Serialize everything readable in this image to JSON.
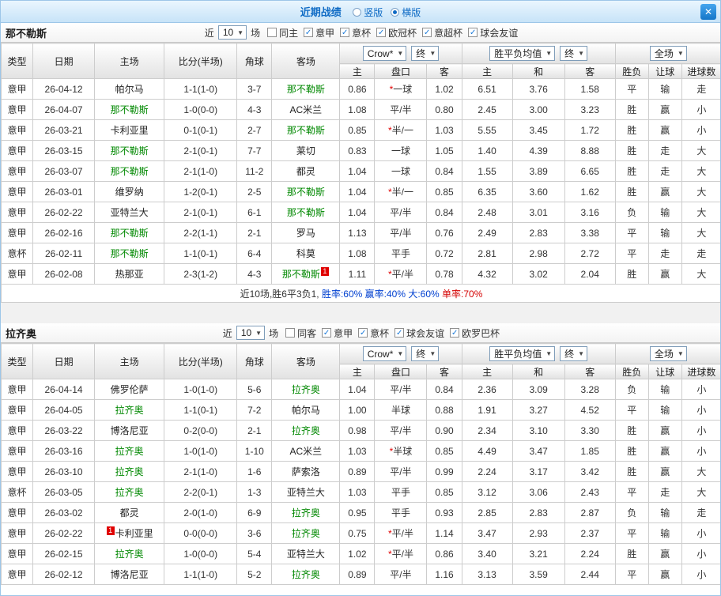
{
  "header": {
    "title": "近期战绩",
    "close_glyph": "✕",
    "layout_options": [
      {
        "label": "竖版",
        "selected": false
      },
      {
        "label": "横版",
        "selected": true
      }
    ]
  },
  "palette": {
    "accent_blue": "#1e8ae2",
    "focus_team_green": "#008800",
    "win_red": "#e00000",
    "draw_blue": "#0040d0",
    "lose_green": "#009100",
    "score_red": "#d40000",
    "odds_blue": "#2a52c0"
  },
  "columns": {
    "main": [
      "类型",
      "日期",
      "主场",
      "比分(半场)",
      "角球",
      "客场"
    ],
    "sub": [
      "主",
      "盘口",
      "客",
      "主",
      "和",
      "客",
      "胜负",
      "让球",
      "进球数"
    ]
  },
  "league_colors": {
    "意甲": "lg-blue",
    "意杯": "lg-purple"
  },
  "result_colors": {
    "胜": "r",
    "赢": "r",
    "大": "r",
    "平": "b",
    "走": "b",
    "负": "g",
    "输": "g",
    "小": "g"
  },
  "sections": [
    {
      "team": "那不勒斯",
      "filter": {
        "prefix": "近",
        "count": "10",
        "suffix": "场",
        "checkboxes": [
          {
            "label": "同主",
            "checked": false
          },
          {
            "label": "意甲",
            "checked": true
          },
          {
            "label": "意杯",
            "checked": true
          },
          {
            "label": "欧冠杯",
            "checked": true
          },
          {
            "label": "意超杯",
            "checked": true
          },
          {
            "label": "球会友谊",
            "checked": true
          }
        ]
      },
      "dropdowns": {
        "company": "Crow*",
        "final1": "终",
        "avg": "胜平负均值",
        "final2": "终",
        "scope": "全场"
      },
      "rows": [
        {
          "league": "意甲",
          "date": "26-04-12",
          "home": "帕尔马",
          "homeFocus": false,
          "homeBadge": "",
          "score": "1-1(1-0)",
          "corner": "3-7",
          "away": "那不勒斯",
          "awayFocus": true,
          "awayBadge": "",
          "odds": [
            "0.86",
            "*一球",
            "1.02"
          ],
          "avg": [
            "6.51",
            "3.76",
            "1.58"
          ],
          "results": [
            "平",
            "输",
            "走"
          ]
        },
        {
          "league": "意甲",
          "date": "26-04-07",
          "home": "那不勒斯",
          "homeFocus": true,
          "homeBadge": "",
          "score": "1-0(0-0)",
          "corner": "4-3",
          "away": "AC米兰",
          "awayFocus": false,
          "awayBadge": "",
          "odds": [
            "1.08",
            "平/半",
            "0.80"
          ],
          "avg": [
            "2.45",
            "3.00",
            "3.23"
          ],
          "results": [
            "胜",
            "赢",
            "小"
          ]
        },
        {
          "league": "意甲",
          "date": "26-03-21",
          "home": "卡利亚里",
          "homeFocus": false,
          "homeBadge": "",
          "score": "0-1(0-1)",
          "corner": "2-7",
          "away": "那不勒斯",
          "awayFocus": true,
          "awayBadge": "",
          "odds": [
            "0.85",
            "*半/一",
            "1.03"
          ],
          "avg": [
            "5.55",
            "3.45",
            "1.72"
          ],
          "results": [
            "胜",
            "赢",
            "小"
          ]
        },
        {
          "league": "意甲",
          "date": "26-03-15",
          "home": "那不勒斯",
          "homeFocus": true,
          "homeBadge": "",
          "score": "2-1(0-1)",
          "corner": "7-7",
          "away": "莱切",
          "awayFocus": false,
          "awayBadge": "",
          "odds": [
            "0.83",
            "一球",
            "1.05"
          ],
          "avg": [
            "1.40",
            "4.39",
            "8.88"
          ],
          "results": [
            "胜",
            "走",
            "大"
          ]
        },
        {
          "league": "意甲",
          "date": "26-03-07",
          "home": "那不勒斯",
          "homeFocus": true,
          "homeBadge": "",
          "score": "2-1(1-0)",
          "corner": "11-2",
          "away": "都灵",
          "awayFocus": false,
          "awayBadge": "",
          "odds": [
            "1.04",
            "一球",
            "0.84"
          ],
          "avg": [
            "1.55",
            "3.89",
            "6.65"
          ],
          "results": [
            "胜",
            "走",
            "大"
          ]
        },
        {
          "league": "意甲",
          "date": "26-03-01",
          "home": "维罗纳",
          "homeFocus": false,
          "homeBadge": "",
          "score": "1-2(0-1)",
          "corner": "2-5",
          "away": "那不勒斯",
          "awayFocus": true,
          "awayBadge": "",
          "odds": [
            "1.04",
            "*半/一",
            "0.85"
          ],
          "avg": [
            "6.35",
            "3.60",
            "1.62"
          ],
          "results": [
            "胜",
            "赢",
            "大"
          ]
        },
        {
          "league": "意甲",
          "date": "26-02-22",
          "home": "亚特兰大",
          "homeFocus": false,
          "homeBadge": "",
          "score": "2-1(0-1)",
          "corner": "6-1",
          "away": "那不勒斯",
          "awayFocus": true,
          "awayBadge": "",
          "odds": [
            "1.04",
            "平/半",
            "0.84"
          ],
          "avg": [
            "2.48",
            "3.01",
            "3.16"
          ],
          "results": [
            "负",
            "输",
            "大"
          ]
        },
        {
          "league": "意甲",
          "date": "26-02-16",
          "home": "那不勒斯",
          "homeFocus": true,
          "homeBadge": "",
          "score": "2-2(1-1)",
          "corner": "2-1",
          "away": "罗马",
          "awayFocus": false,
          "awayBadge": "",
          "odds": [
            "1.13",
            "平/半",
            "0.76"
          ],
          "avg": [
            "2.49",
            "2.83",
            "3.38"
          ],
          "results": [
            "平",
            "输",
            "大"
          ]
        },
        {
          "league": "意杯",
          "date": "26-02-11",
          "home": "那不勒斯",
          "homeFocus": true,
          "homeBadge": "",
          "score": "1-1(0-1)",
          "corner": "6-4",
          "away": "科莫",
          "awayFocus": false,
          "awayBadge": "",
          "odds": [
            "1.08",
            "平手",
            "0.72"
          ],
          "avg": [
            "2.81",
            "2.98",
            "2.72"
          ],
          "results": [
            "平",
            "走",
            "走"
          ]
        },
        {
          "league": "意甲",
          "date": "26-02-08",
          "home": "热那亚",
          "homeFocus": false,
          "homeBadge": "",
          "score": "2-3(1-2)",
          "corner": "4-3",
          "away": "那不勒斯",
          "awayFocus": true,
          "awayBadge": "1",
          "odds": [
            "1.11",
            "*平/半",
            "0.78"
          ],
          "avg": [
            "4.32",
            "3.02",
            "2.04"
          ],
          "results": [
            "胜",
            "赢",
            "大"
          ]
        }
      ],
      "summary": [
        {
          "text": "近10场,胜6平3负1, ",
          "color": "dark"
        },
        {
          "text": "胜率:60%",
          "color": "blue"
        },
        {
          "text": " 赢率:40%",
          "color": "blue"
        },
        {
          "text": " 大:60%",
          "color": "blue"
        },
        {
          "text": " 单率:70%",
          "color": "red"
        }
      ]
    },
    {
      "team": "拉齐奥",
      "filter": {
        "prefix": "近",
        "count": "10",
        "suffix": "场",
        "checkboxes": [
          {
            "label": "同客",
            "checked": false
          },
          {
            "label": "意甲",
            "checked": true
          },
          {
            "label": "意杯",
            "checked": true
          },
          {
            "label": "球会友谊",
            "checked": true
          },
          {
            "label": "欧罗巴杯",
            "checked": true
          }
        ]
      },
      "dropdowns": {
        "company": "Crow*",
        "final1": "终",
        "avg": "胜平负均值",
        "final2": "终",
        "scope": "全场"
      },
      "rows": [
        {
          "league": "意甲",
          "date": "26-04-14",
          "home": "佛罗伦萨",
          "homeFocus": false,
          "homeBadge": "",
          "score": "1-0(1-0)",
          "corner": "5-6",
          "away": "拉齐奥",
          "awayFocus": true,
          "awayBadge": "",
          "odds": [
            "1.04",
            "平/半",
            "0.84"
          ],
          "avg": [
            "2.36",
            "3.09",
            "3.28"
          ],
          "results": [
            "负",
            "输",
            "小"
          ]
        },
        {
          "league": "意甲",
          "date": "26-04-05",
          "home": "拉齐奥",
          "homeFocus": true,
          "homeBadge": "",
          "score": "1-1(0-1)",
          "corner": "7-2",
          "away": "帕尔马",
          "awayFocus": false,
          "awayBadge": "",
          "odds": [
            "1.00",
            "半球",
            "0.88"
          ],
          "avg": [
            "1.91",
            "3.27",
            "4.52"
          ],
          "results": [
            "平",
            "输",
            "小"
          ]
        },
        {
          "league": "意甲",
          "date": "26-03-22",
          "home": "博洛尼亚",
          "homeFocus": false,
          "homeBadge": "",
          "score": "0-2(0-0)",
          "corner": "2-1",
          "away": "拉齐奥",
          "awayFocus": true,
          "awayBadge": "",
          "odds": [
            "0.98",
            "平/半",
            "0.90"
          ],
          "avg": [
            "2.34",
            "3.10",
            "3.30"
          ],
          "results": [
            "胜",
            "赢",
            "小"
          ]
        },
        {
          "league": "意甲",
          "date": "26-03-16",
          "home": "拉齐奥",
          "homeFocus": true,
          "homeBadge": "",
          "score": "1-0(1-0)",
          "corner": "1-10",
          "away": "AC米兰",
          "awayFocus": false,
          "awayBadge": "",
          "odds": [
            "1.03",
            "*半球",
            "0.85"
          ],
          "avg": [
            "4.49",
            "3.47",
            "1.85"
          ],
          "results": [
            "胜",
            "赢",
            "小"
          ]
        },
        {
          "league": "意甲",
          "date": "26-03-10",
          "home": "拉齐奥",
          "homeFocus": true,
          "homeBadge": "",
          "score": "2-1(1-0)",
          "corner": "1-6",
          "away": "萨索洛",
          "awayFocus": false,
          "awayBadge": "",
          "odds": [
            "0.89",
            "平/半",
            "0.99"
          ],
          "avg": [
            "2.24",
            "3.17",
            "3.42"
          ],
          "results": [
            "胜",
            "赢",
            "大"
          ]
        },
        {
          "league": "意杯",
          "date": "26-03-05",
          "home": "拉齐奥",
          "homeFocus": true,
          "homeBadge": "",
          "score": "2-2(0-1)",
          "corner": "1-3",
          "away": "亚特兰大",
          "awayFocus": false,
          "awayBadge": "",
          "odds": [
            "1.03",
            "平手",
            "0.85"
          ],
          "avg": [
            "3.12",
            "3.06",
            "2.43"
          ],
          "results": [
            "平",
            "走",
            "大"
          ]
        },
        {
          "league": "意甲",
          "date": "26-03-02",
          "home": "都灵",
          "homeFocus": false,
          "homeBadge": "",
          "score": "2-0(1-0)",
          "corner": "6-9",
          "away": "拉齐奥",
          "awayFocus": true,
          "awayBadge": "",
          "odds": [
            "0.95",
            "平手",
            "0.93"
          ],
          "avg": [
            "2.85",
            "2.83",
            "2.87"
          ],
          "results": [
            "负",
            "输",
            "走"
          ]
        },
        {
          "league": "意甲",
          "date": "26-02-22",
          "home": "卡利亚里",
          "homeFocus": false,
          "homeBadge": "1",
          "score": "0-0(0-0)",
          "corner": "3-6",
          "away": "拉齐奥",
          "awayFocus": true,
          "awayBadge": "",
          "odds": [
            "0.75",
            "*平/半",
            "1.14"
          ],
          "avg": [
            "3.47",
            "2.93",
            "2.37"
          ],
          "results": [
            "平",
            "输",
            "小"
          ]
        },
        {
          "league": "意甲",
          "date": "26-02-15",
          "home": "拉齐奥",
          "homeFocus": true,
          "homeBadge": "",
          "score": "1-0(0-0)",
          "corner": "5-4",
          "away": "亚特兰大",
          "awayFocus": false,
          "awayBadge": "",
          "odds": [
            "1.02",
            "*平/半",
            "0.86"
          ],
          "avg": [
            "3.40",
            "3.21",
            "2.24"
          ],
          "results": [
            "胜",
            "赢",
            "小"
          ]
        },
        {
          "league": "意甲",
          "date": "26-02-12",
          "home": "博洛尼亚",
          "homeFocus": false,
          "homeBadge": "",
          "score": "1-1(1-0)",
          "corner": "5-2",
          "away": "拉齐奥",
          "awayFocus": true,
          "awayBadge": "",
          "odds": [
            "0.89",
            "平/半",
            "1.16"
          ],
          "avg": [
            "3.13",
            "3.59",
            "2.44"
          ],
          "results": [
            "平",
            "赢",
            "小"
          ]
        }
      ],
      "summary": null
    }
  ]
}
